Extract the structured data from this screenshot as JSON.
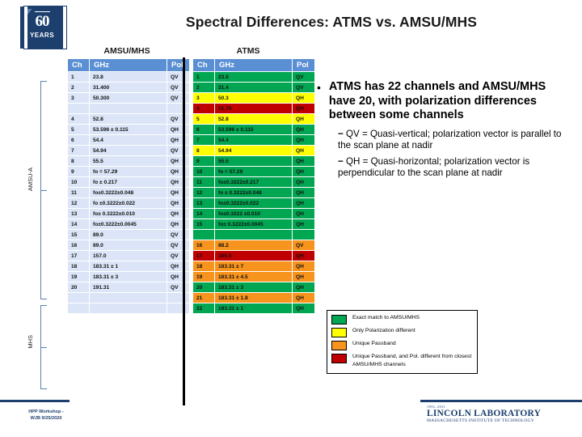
{
  "title": "Spectral Differences: ATMS vs. AMSU/MHS",
  "logo": {
    "number": "60",
    "years": "YEARS"
  },
  "table": {
    "group_left": "AMSU/MHS",
    "group_right": "ATMS",
    "headers": {
      "ch": "Ch",
      "ghz": "GHz",
      "pol": "Pol"
    },
    "rows": [
      {
        "amsu": {
          "ch": "1",
          "ghz": "23.8",
          "pol": "QV"
        },
        "atms": {
          "ch": "1",
          "ghz": "23.8",
          "pol": "QV",
          "color": "green"
        }
      },
      {
        "amsu": {
          "ch": "2",
          "ghz": "31.400",
          "pol": "QV"
        },
        "atms": {
          "ch": "2",
          "ghz": "31.4",
          "pol": "QV",
          "color": "green"
        }
      },
      {
        "amsu": {
          "ch": "3",
          "ghz": "50.300",
          "pol": "QV"
        },
        "atms": {
          "ch": "3",
          "ghz": "50.3",
          "pol": "QH",
          "color": "yellow"
        }
      },
      {
        "amsu": {
          "ch": "",
          "ghz": "",
          "pol": ""
        },
        "atms": {
          "ch": "4",
          "ghz": "51.76",
          "pol": "QH",
          "color": "red"
        }
      },
      {
        "amsu": {
          "ch": "4",
          "ghz": "52.8",
          "pol": "QV"
        },
        "atms": {
          "ch": "5",
          "ghz": "52.8",
          "pol": "QH",
          "color": "yellow"
        }
      },
      {
        "amsu": {
          "ch": "5",
          "ghz": "53.596 ± 0.115",
          "pol": "QH"
        },
        "atms": {
          "ch": "6",
          "ghz": "53.596 ± 0.115",
          "pol": "QH",
          "color": "green"
        }
      },
      {
        "amsu": {
          "ch": "6",
          "ghz": "54.4",
          "pol": "QH"
        },
        "atms": {
          "ch": "7",
          "ghz": "54.4",
          "pol": "QH",
          "color": "green"
        }
      },
      {
        "amsu": {
          "ch": "7",
          "ghz": "54.94",
          "pol": "QV"
        },
        "atms": {
          "ch": "8",
          "ghz": "54.94",
          "pol": "QH",
          "color": "yellow"
        }
      },
      {
        "amsu": {
          "ch": "8",
          "ghz": "55.5",
          "pol": "QH"
        },
        "atms": {
          "ch": "9",
          "ghz": "55.5",
          "pol": "QH",
          "color": "green"
        }
      },
      {
        "amsu": {
          "ch": "9",
          "ghz": "fo = 57.29",
          "pol": "QH"
        },
        "atms": {
          "ch": "10",
          "ghz": "fo = 57.29",
          "pol": "QH",
          "color": "green"
        }
      },
      {
        "amsu": {
          "ch": "10",
          "ghz": "fo ± 0.217",
          "pol": "QH"
        },
        "atms": {
          "ch": "11",
          "ghz": "fo±0.3222±0.217",
          "pol": "QH",
          "color": "green"
        }
      },
      {
        "amsu": {
          "ch": "11",
          "ghz": "fo±0.3222±0.048",
          "pol": "QH"
        },
        "atms": {
          "ch": "12",
          "ghz": "fo ± 0.3222±0.048",
          "pol": "QH",
          "color": "green"
        }
      },
      {
        "amsu": {
          "ch": "12",
          "ghz": "fo ±0.3222±0.022",
          "pol": "QH"
        },
        "atms": {
          "ch": "13",
          "ghz": "fo±0.3222±0.022",
          "pol": "QH",
          "color": "green"
        }
      },
      {
        "amsu": {
          "ch": "13",
          "ghz": "fo± 0.3222±0.010",
          "pol": "QH"
        },
        "atms": {
          "ch": "14",
          "ghz": "fo±0.3222 ±0.010",
          "pol": "QH",
          "color": "green"
        }
      },
      {
        "amsu": {
          "ch": "14",
          "ghz": "fo±0.3222±0.0045",
          "pol": "QH"
        },
        "atms": {
          "ch": "15",
          "ghz": "fo± 0.3222±0.0045",
          "pol": "QH",
          "color": "green"
        }
      },
      {
        "amsu": {
          "ch": "15",
          "ghz": "89.0",
          "pol": "QV"
        },
        "atms": {
          "ch": "",
          "ghz": "",
          "pol": "",
          "color": "green"
        }
      },
      {
        "amsu": {
          "ch": "16",
          "ghz": "89.0",
          "pol": "QV"
        },
        "atms": {
          "ch": "16",
          "ghz": "88.2",
          "pol": "QV",
          "color": "orange"
        }
      },
      {
        "amsu": {
          "ch": "17",
          "ghz": "157.0",
          "pol": "QV"
        },
        "atms": {
          "ch": "17",
          "ghz": "165.5",
          "pol": "QH",
          "color": "red"
        }
      },
      {
        "amsu": {
          "ch": "18",
          "ghz": "183.31 ± 1",
          "pol": "QH"
        },
        "atms": {
          "ch": "18",
          "ghz": "183.31 ± 7",
          "pol": "QH",
          "color": "orange"
        }
      },
      {
        "amsu": {
          "ch": "19",
          "ghz": "183.31 ± 3",
          "pol": "QH"
        },
        "atms": {
          "ch": "19",
          "ghz": "183.31 ± 4.5",
          "pol": "QH",
          "color": "orange"
        }
      },
      {
        "amsu": {
          "ch": "20",
          "ghz": "191.31",
          "pol": "QV"
        },
        "atms": {
          "ch": "20",
          "ghz": "183.31 ± 3",
          "pol": "QH",
          "color": "green"
        }
      },
      {
        "amsu": {
          "ch": "",
          "ghz": "",
          "pol": ""
        },
        "atms": {
          "ch": "21",
          "ghz": "183.31 ± 1.8",
          "pol": "QH",
          "color": "orange"
        }
      },
      {
        "amsu": {
          "ch": "",
          "ghz": "",
          "pol": ""
        },
        "atms": {
          "ch": "22",
          "ghz": "183.31 ± 1",
          "pol": "QH",
          "color": "green"
        }
      }
    ]
  },
  "side_labels": {
    "amsu_a": "AMSU-A",
    "mhs": "MHS"
  },
  "bullets": {
    "main": "ATMS has 22 channels and AMSU/MHS have 20, with polarization differences between some channels",
    "sub1_dash": "−",
    "sub1": "QV = Quasi-vertical; polarization vector is parallel to the scan plane at nadir",
    "sub2_dash": "−",
    "sub2": "QH = Quasi-horizontal; polarization vector is perpendicular to the scan plane at nadir"
  },
  "legend": {
    "items": [
      {
        "color": "#00a651",
        "label": "Exact match to AMSU/MHS"
      },
      {
        "color": "#ffff00",
        "label": "Only Polarization different"
      },
      {
        "color": "#f7941e",
        "label": "Unique Passband"
      },
      {
        "color": "#c00000",
        "label": "Unique Passband, and Pol. different from closest AMSU/MHS channels"
      }
    ]
  },
  "footer": {
    "left_line1": "HPP Workshop -",
    "left_line2": "WJB 9/25/2020",
    "ll_years": "1951–2011",
    "ll_name": "LINCOLN LABORATORY",
    "ll_sub": "MASSACHUSETTS INSTITUTE OF TECHNOLOGY"
  }
}
